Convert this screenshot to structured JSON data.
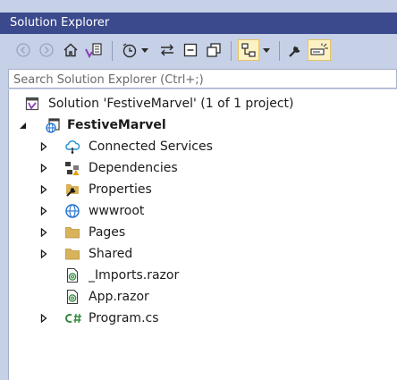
{
  "panel": {
    "title": "Solution Explorer"
  },
  "toolbar": {
    "icons": [
      "back-icon",
      "forward-icon",
      "home-icon",
      "switch-views-icon",
      "pending-changes-filter-icon",
      "dropdown-icon",
      "sync-with-active-document-icon",
      "collapse-all-icon",
      "show-all-files-icon",
      "preview-selected-items-icon",
      "dropdown-icon",
      "properties-icon",
      "toggle-icon"
    ]
  },
  "search": {
    "placeholder": "Search Solution Explorer (Ctrl+;)"
  },
  "tree": {
    "solution_label": "Solution 'FestiveMarvel' (1 of 1 project)",
    "project_label": "FestiveMarvel",
    "items": [
      {
        "label": "Connected Services",
        "icon": "connected-services-icon",
        "expandable": true
      },
      {
        "label": "Dependencies",
        "icon": "dependencies-icon",
        "expandable": true
      },
      {
        "label": "Properties",
        "icon": "properties-folder-icon",
        "expandable": true
      },
      {
        "label": "wwwroot",
        "icon": "globe-icon",
        "expandable": true
      },
      {
        "label": "Pages",
        "icon": "folder-icon",
        "expandable": true
      },
      {
        "label": "Shared",
        "icon": "folder-icon",
        "expandable": true
      },
      {
        "label": "_Imports.razor",
        "icon": "razor-file-icon",
        "expandable": false
      },
      {
        "label": "App.razor",
        "icon": "razor-file-icon",
        "expandable": false
      },
      {
        "label": "Program.cs",
        "icon": "csharp-file-icon",
        "expandable": true
      }
    ]
  },
  "colors": {
    "title_bar": "#3b4a8c",
    "panel_bg": "#c6d0e6",
    "tree_bg": "#ffffff",
    "folder": "#d8b35a"
  }
}
